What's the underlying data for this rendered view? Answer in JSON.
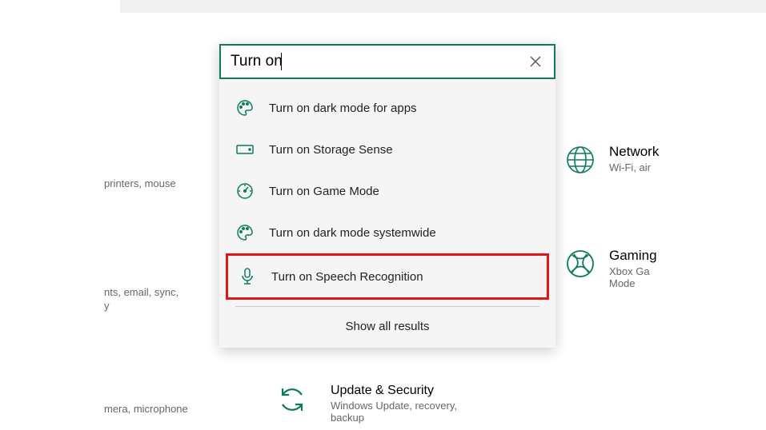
{
  "search": {
    "value": "Turn on",
    "clear_title": "Clear"
  },
  "results": [
    {
      "icon": "palette",
      "label": "Turn on dark mode for apps"
    },
    {
      "icon": "drive",
      "label": "Turn on Storage Sense"
    },
    {
      "icon": "gauge",
      "label": "Turn on Game Mode"
    },
    {
      "icon": "palette",
      "label": "Turn on dark mode systemwide"
    },
    {
      "icon": "mic",
      "label": "Turn on Speech Recognition",
      "highlighted": true
    }
  ],
  "show_all": "Show all results",
  "bg_fragments": {
    "devices_sub": "printers, mouse",
    "accounts_sub1": "nts, email, sync,",
    "accounts_sub2": "y",
    "privacy_sub": "mera, microphone"
  },
  "right": {
    "network": {
      "title": "Network",
      "sub": "Wi-Fi, air"
    },
    "gaming": {
      "title": "Gaming",
      "sub1": "Xbox Ga",
      "sub2": "Mode"
    }
  },
  "update": {
    "title": "Update & Security",
    "sub": "Windows Update, recovery, backup"
  },
  "colors": {
    "accent": "#0d7a5f",
    "highlight": "#e01515"
  }
}
